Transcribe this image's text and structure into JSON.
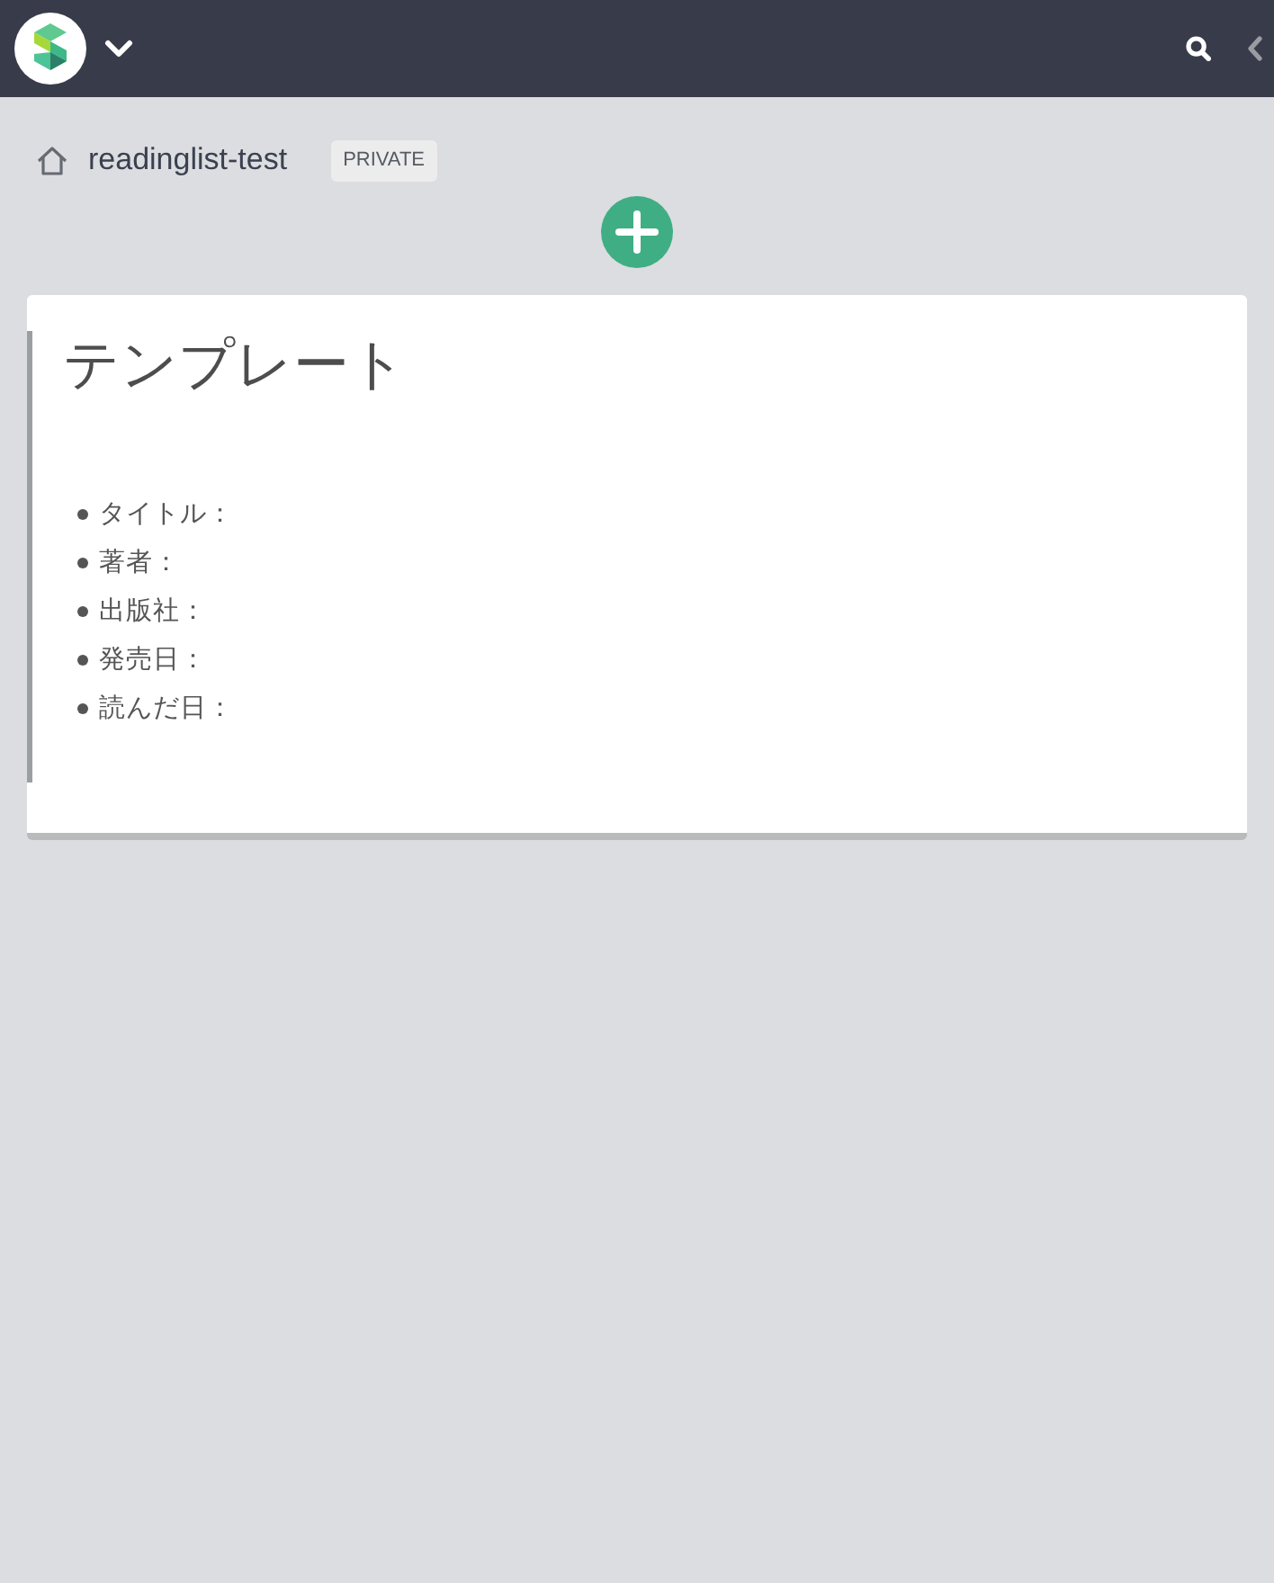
{
  "breadcrumb": {
    "title": "readinglist-test",
    "badge": "PRIVATE"
  },
  "note": {
    "title": "テンプレート",
    "items": [
      "タイトル：",
      "著者：",
      "出版社：",
      "発売日：",
      "読んだ日："
    ]
  }
}
